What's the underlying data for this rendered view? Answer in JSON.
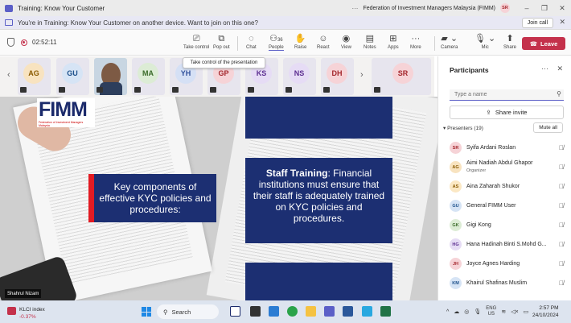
{
  "window": {
    "title": "Training: Know Your Customer",
    "org": "Federation of Investment Managers Malaysia (FIMM)",
    "user_initials": "SR",
    "more": "···"
  },
  "banner": {
    "text": "You're in Training: Know Your Customer on another device. Want to join on this one?",
    "join_label": "Join call"
  },
  "toolbar": {
    "timer": "02:52:11",
    "buttons": [
      {
        "label": "Take control",
        "icon": "cast-icon"
      },
      {
        "label": "Pop out",
        "icon": "popout-icon"
      },
      {
        "label": "Chat",
        "icon": "chat-icon"
      },
      {
        "label": "People",
        "icon": "people-icon",
        "badge": "36"
      },
      {
        "label": "Raise",
        "icon": "hand-icon"
      },
      {
        "label": "React",
        "icon": "smile-icon"
      },
      {
        "label": "View",
        "icon": "view-icon"
      },
      {
        "label": "Notes",
        "icon": "notes-icon"
      },
      {
        "label": "Apps",
        "icon": "apps-icon"
      },
      {
        "label": "More",
        "icon": "more-icon"
      },
      {
        "label": "Camera",
        "icon": "camera-off-icon"
      },
      {
        "label": "Mic",
        "icon": "mic-off-icon"
      },
      {
        "label": "Share",
        "icon": "share-icon"
      }
    ],
    "leave_label": "Leave"
  },
  "tooltip": "Take control of the presentation",
  "strip": {
    "tiles": [
      {
        "initials": "AG",
        "color": "#f8e3c0",
        "fg": "#8a5a00"
      },
      {
        "initials": "GU",
        "color": "#d6e4f5",
        "fg": "#1b4f8a"
      },
      {
        "initials": "",
        "photo": true
      },
      {
        "initials": "MA",
        "color": "#dcecd5",
        "fg": "#3b6b2a"
      },
      {
        "initials": "YH",
        "color": "#d5e0f5",
        "fg": "#2f4f9a"
      },
      {
        "initials": "GP",
        "color": "#f6d3d7",
        "fg": "#a4262c"
      },
      {
        "initials": "KS",
        "color": "#e6dcf5",
        "fg": "#5c2e91"
      },
      {
        "initials": "NS",
        "color": "#e6dcf5",
        "fg": "#5c2e91"
      },
      {
        "initials": "DH",
        "color": "#f6d3d7",
        "fg": "#a4262c"
      },
      {
        "initials": "SR",
        "color": "#f6d3d7",
        "fg": "#a4262c"
      }
    ]
  },
  "slide": {
    "logo_text": "FIMM",
    "logo_sub": "Federation of Investment Managers Malaysia",
    "left_box": "Key components of effective KYC policies and procedures:",
    "right_bold": "Staff Training",
    "right_text": ": Financial institutions must ensure that their staff is adequately trained on KYC policies and procedures.",
    "presenter_name": "Shahrul Nizam"
  },
  "participants": {
    "title": "Participants",
    "search_placeholder": "Type a name",
    "share_invite": "Share invite",
    "presenters_label": "Presenters (19)",
    "mute_all": "Mute all",
    "list": [
      {
        "initials": "SR",
        "name": "Syifa Ardani Roslan",
        "sub": "",
        "bg": "#f6d3d7",
        "fg": "#a4262c"
      },
      {
        "initials": "AG",
        "name": "Aimi Nadiah Abdul Ghapor",
        "sub": "Organizer",
        "bg": "#f8e3c0",
        "fg": "#8a5a00"
      },
      {
        "initials": "AS",
        "name": "Aina Zaharah Shukor",
        "sub": "",
        "bg": "#fbe8c4",
        "fg": "#8a5a00"
      },
      {
        "initials": "GU",
        "name": "General FIMM User",
        "sub": "",
        "bg": "#d6e4f5",
        "fg": "#1b4f8a"
      },
      {
        "initials": "GK",
        "name": "Gigi Kong",
        "sub": "",
        "bg": "#dcecd5",
        "fg": "#3b6b2a"
      },
      {
        "initials": "HG",
        "name": "Hana Hadinah Binti S.Mohd G...",
        "sub": "",
        "bg": "#e6dcf5",
        "fg": "#5c2e91"
      },
      {
        "initials": "JH",
        "name": "Joyce Agnes Harding",
        "sub": "",
        "bg": "#f6d3d7",
        "fg": "#a4262c"
      },
      {
        "initials": "KM",
        "name": "Khairul Shafinas Muslim",
        "sub": "",
        "bg": "#d6e4f5",
        "fg": "#1b4f8a"
      }
    ]
  },
  "taskbar": {
    "stock_name": "KLCI index",
    "stock_change": "-0.37%",
    "search_label": "Search",
    "lang": "ENG",
    "region": "US",
    "time": "2:57 PM",
    "date": "24/10/2024"
  }
}
